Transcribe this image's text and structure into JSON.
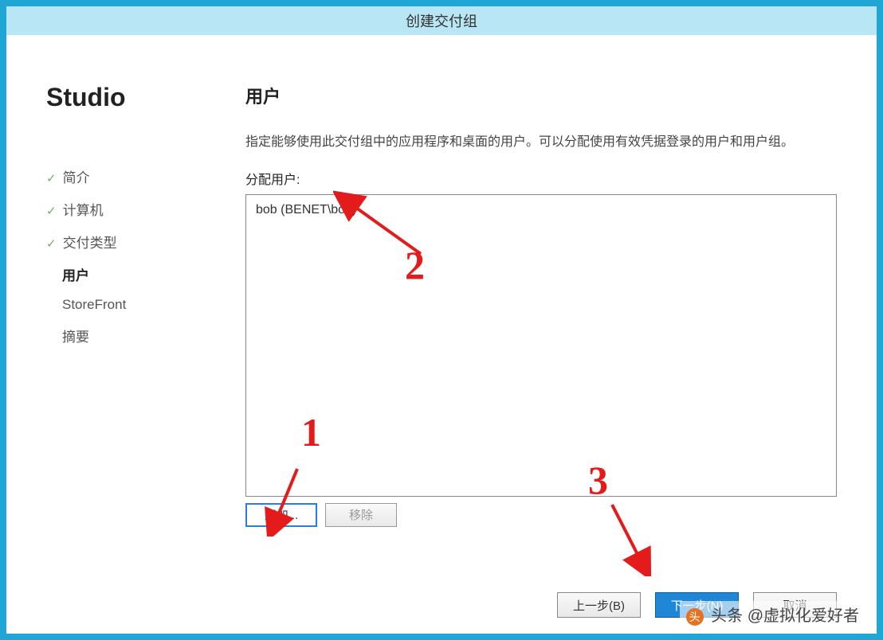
{
  "window": {
    "title": "创建交付组"
  },
  "sidebar": {
    "logo": "Studio",
    "items": [
      {
        "label": "简介",
        "state": "completed"
      },
      {
        "label": "计算机",
        "state": "completed"
      },
      {
        "label": "交付类型",
        "state": "completed"
      },
      {
        "label": "用户",
        "state": "current"
      },
      {
        "label": "StoreFront",
        "state": "pending"
      },
      {
        "label": "摘要",
        "state": "pending"
      }
    ]
  },
  "main": {
    "title": "用户",
    "description": "指定能够使用此交付组中的应用程序和桌面的用户。可以分配使用有效凭据登录的用户和用户组。",
    "assign_label": "分配用户:",
    "users": [
      "bob (BENET\\bob)"
    ],
    "add_button": "添加...",
    "remove_button": "移除"
  },
  "wizard": {
    "back": "上一步(B)",
    "next": "下一步(N)",
    "cancel": "取消"
  },
  "annotations": {
    "one": "1",
    "two": "2",
    "three": "3"
  },
  "watermark": {
    "text": "头条 @虚拟化爱好者",
    "icon": "头"
  }
}
